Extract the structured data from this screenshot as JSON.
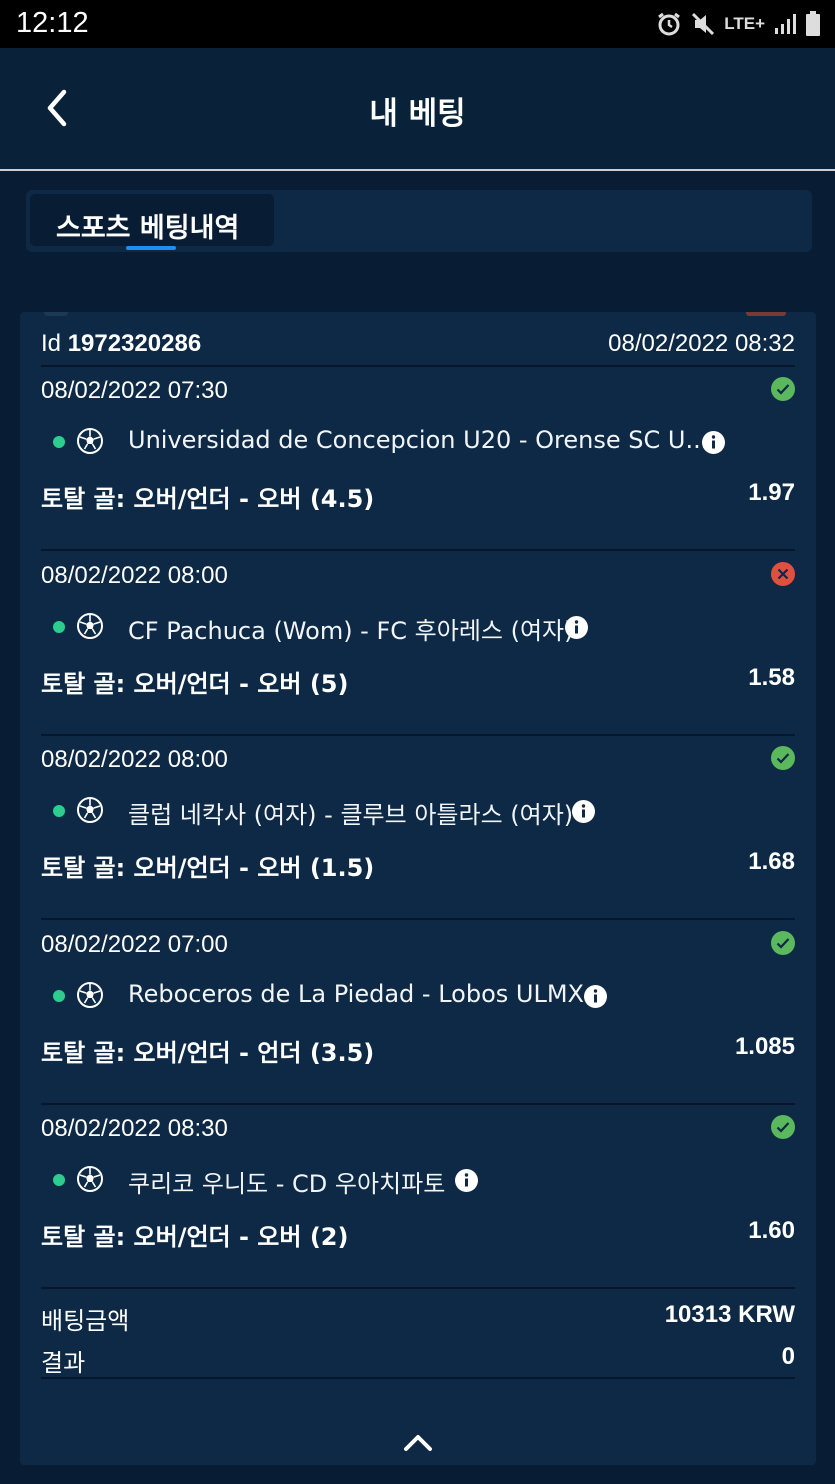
{
  "status_bar": {
    "time": "12:12",
    "network": "LTE+"
  },
  "header": {
    "title": "내 베팅"
  },
  "tabs": [
    {
      "label": "스포츠 베팅내역",
      "active": true
    }
  ],
  "bet": {
    "id_label": "Id",
    "id_value": "1972320286",
    "created": "08/02/2022 08:32",
    "legs": [
      {
        "time": "08/02/2022 07:30",
        "status": "won",
        "match": "Universidad de Concepcion U20 - Orense SC U...",
        "market": "토탈 골: 오버/언더 - 오버 (4.5)",
        "odds": "1.97"
      },
      {
        "time": "08/02/2022 08:00",
        "status": "lost",
        "match": "CF Pachuca (Wom) - FC 후아레스 (여자)",
        "market": "토탈 골: 오버/언더 - 오버 (5)",
        "odds": "1.58"
      },
      {
        "time": "08/02/2022 08:00",
        "status": "won",
        "match": "클럽 네칵사 (여자) - 클루브 아틀라스 (여자)",
        "market": "토탈 골: 오버/언더 - 오버 (1.5)",
        "odds": "1.68"
      },
      {
        "time": "08/02/2022 07:00",
        "status": "won",
        "match": "Reboceros de La Piedad - Lobos ULMX",
        "market": "토탈 골: 오버/언더 - 언더 (3.5)",
        "odds": "1.085"
      },
      {
        "time": "08/02/2022 08:30",
        "status": "won",
        "match": "쿠리코 우니도 - CD 우아치파토",
        "market": "토탈 골: 오버/언더 - 오버 (2)",
        "odds": "1.60"
      }
    ],
    "stake_label": "배팅금액",
    "stake_value": "10313 KRW",
    "result_label": "결과",
    "result_value": "0"
  },
  "colors": {
    "background": "#081d33",
    "card": "#0d2945",
    "won": "#5cb85c",
    "lost": "#e0503e",
    "live": "#2ecc8f",
    "accent": "#1d8ff3"
  },
  "icons": {
    "back": "chevron-left-icon",
    "sport": "soccer-ball-icon",
    "info": "info-icon",
    "won": "check-circle-icon",
    "lost": "x-circle-icon",
    "collapse": "chevron-up-icon"
  }
}
